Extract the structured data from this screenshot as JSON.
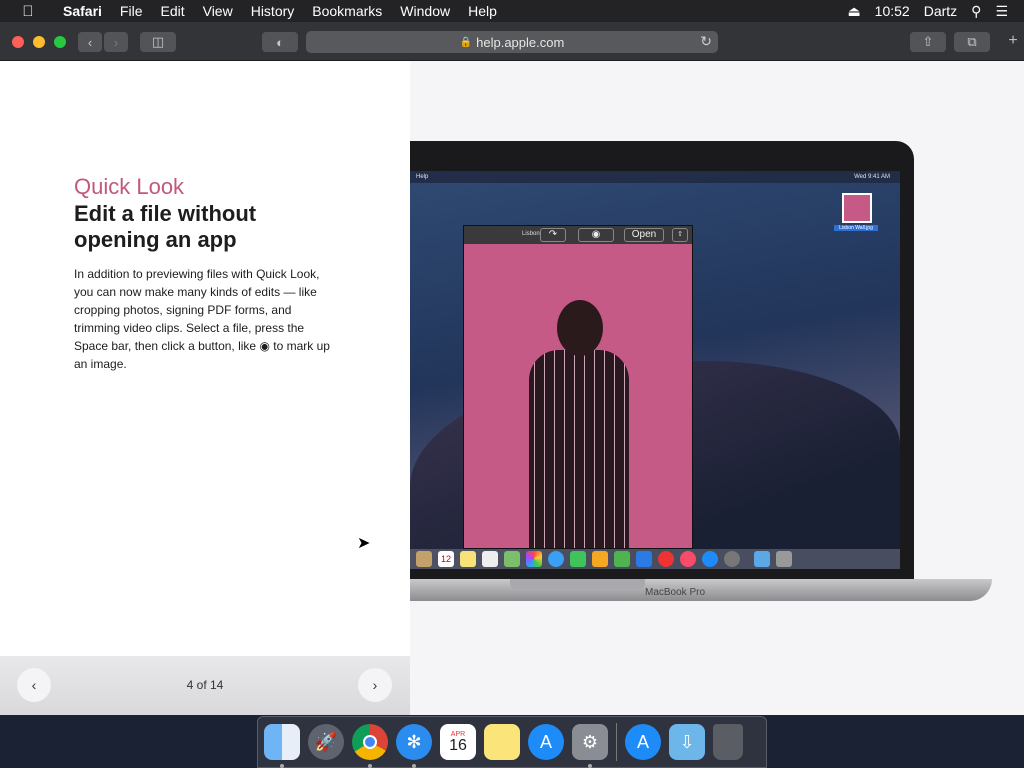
{
  "menubar": {
    "app_name": "Safari",
    "items": [
      "File",
      "Edit",
      "View",
      "History",
      "Bookmarks",
      "Window",
      "Help"
    ],
    "time": "10:52",
    "user": "Dartz"
  },
  "toolbar": {
    "url": "help.apple.com"
  },
  "article": {
    "kicker": "Quick Look",
    "headline": "Edit a file without opening an app",
    "body": "In addition to previewing files with Quick Look, you can now make many kinds of edits — like cropping photos, signing PDF forms, and trimming video clips. Select a file, press the Space bar, then click a button, like ◉ to mark up an image."
  },
  "pager": {
    "counter": "4 of 14",
    "prev_icon": "chevron-left-icon",
    "next_icon": "chevron-right-icon"
  },
  "laptop": {
    "label": "MacBook Pro",
    "mini_menu_left": "Help",
    "mini_menu_right": "Wed 9:41 AM",
    "ql_title": "Lisbon",
    "ql_open": "Open",
    "thumb_label": "Lisbon Wall.jpg",
    "mini_calendar_day": "12"
  },
  "dock": {
    "calendar_month": "APR",
    "calendar_day": "16",
    "apps": [
      "Finder",
      "Launchpad",
      "Chrome",
      "Safari",
      "Calendar",
      "Notes",
      "App Store",
      "System Preferences",
      "App Store",
      "Downloads",
      "Trash"
    ]
  }
}
